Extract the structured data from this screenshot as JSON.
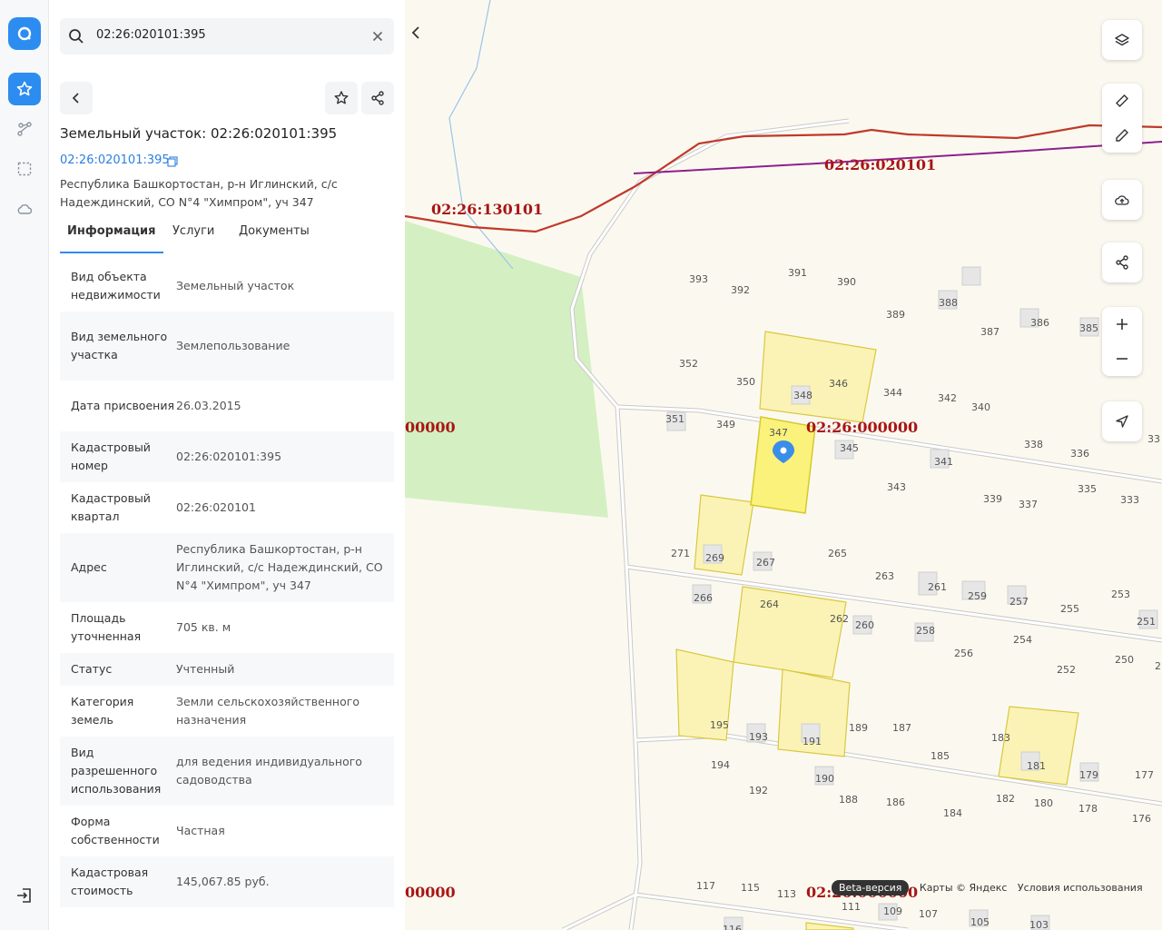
{
  "search": {
    "value": "02:26:020101:395"
  },
  "header": {
    "title": "Земельный участок: 02:26:020101:395",
    "cadastral_link": "02:26:020101:395",
    "address": "Республика Башкортостан, р-н Иглинский, с/с Надеждинский, СО N°4 \"Химпром\", уч 347"
  },
  "tabs": [
    {
      "label": "Информация"
    },
    {
      "label": "Услуги"
    },
    {
      "label": "Документы"
    }
  ],
  "info": [
    {
      "key": "Вид объекта недвижимости",
      "value": "Земельный участок"
    },
    {
      "key": "Вид земельного участка",
      "value": "Землепользование"
    },
    {
      "key": "Дата присвоения",
      "value": "26.03.2015"
    },
    {
      "key": "Кадастровый номер",
      "value": "02:26:020101:395"
    },
    {
      "key": "Кадастровый квартал",
      "value": "02:26:020101"
    },
    {
      "key": "Адрес",
      "value": "Республика Башкортостан, р-н Иглинский, с/с Надеждинский, СО N°4 \"Химпром\", уч 347"
    },
    {
      "key": "Площадь уточненная",
      "value": "705 кв. м"
    },
    {
      "key": "Статус",
      "value": "Учтенный"
    },
    {
      "key": "Категория земель",
      "value": "Земли сельскохозяйственного назначения"
    },
    {
      "key": "Вид разрешенного использования",
      "value": "для ведения индивидуального садоводства"
    },
    {
      "key": "Форма собственности",
      "value": "Частная"
    },
    {
      "key": "Кадастровая стоимость",
      "value": "145,067.85 руб."
    }
  ],
  "map": {
    "quarter_labels": [
      "02:26:130101",
      "02:26:020101",
      "02:26:000000",
      "00000",
      "00000",
      "02:26:000000"
    ],
    "parcel_numbers": [
      "393",
      "392",
      "391",
      "390",
      "389",
      "388",
      "387",
      "386",
      "385",
      "352",
      "350",
      "348",
      "346",
      "344",
      "342",
      "340",
      "351",
      "349",
      "347",
      "345",
      "341",
      "338",
      "336",
      "33",
      "343",
      "339",
      "337",
      "335",
      "333",
      "271",
      "269",
      "267",
      "265",
      "263",
      "261",
      "259",
      "257",
      "255",
      "253",
      "266",
      "264",
      "262",
      "260",
      "258",
      "256",
      "254",
      "251",
      "252",
      "250",
      "2",
      "195",
      "193",
      "191",
      "189",
      "187",
      "183",
      "194",
      "185",
      "181",
      "179",
      "177",
      "192",
      "190",
      "188",
      "186",
      "184",
      "182",
      "180",
      "178",
      "176",
      "117",
      "115",
      "113",
      "111",
      "109",
      "107",
      "105",
      "103",
      "116"
    ],
    "attribution": {
      "beta": "Beta-версия",
      "maps": "Карты © Яндекс",
      "terms": "Условия использования"
    }
  }
}
